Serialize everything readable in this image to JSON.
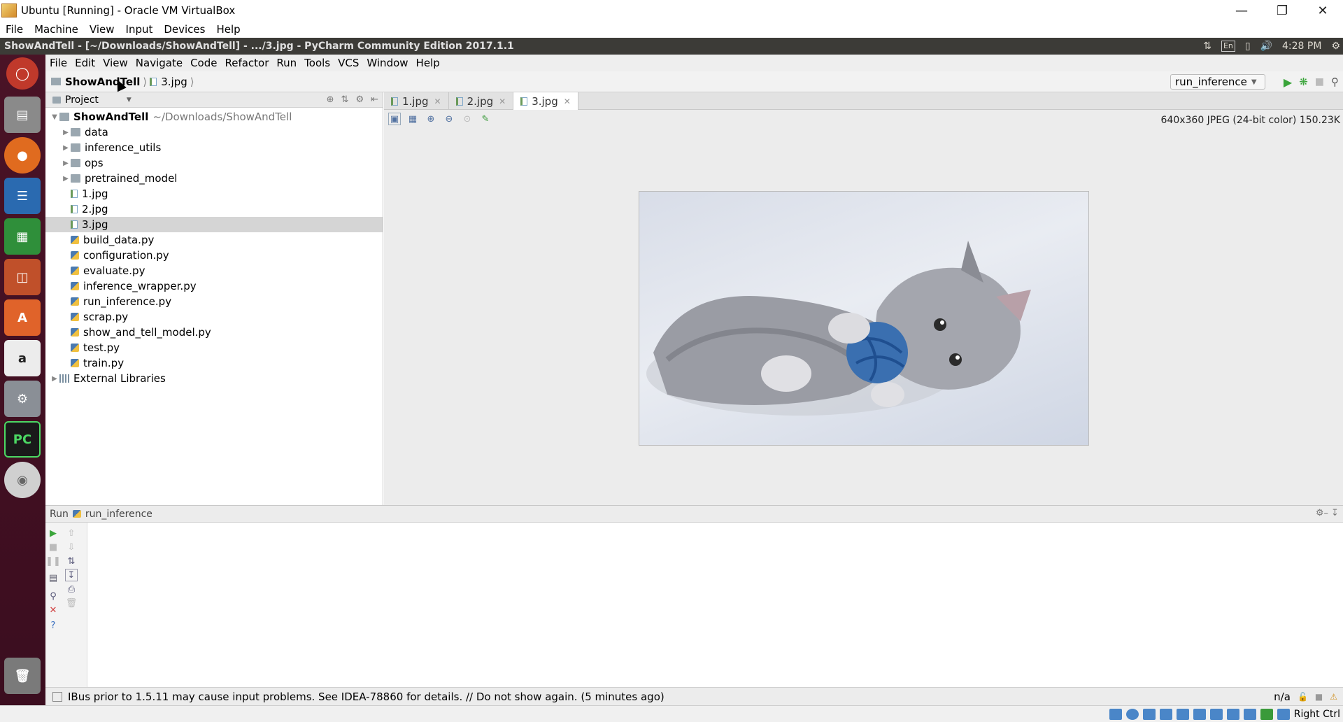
{
  "host": {
    "title": "Ubuntu [Running] - Oracle VM VirtualBox",
    "menu": [
      "File",
      "Machine",
      "View",
      "Input",
      "Devices",
      "Help"
    ],
    "status_right": "Right Ctrl"
  },
  "ubuntu_panel": {
    "window_title": "ShowAndTell - [~/Downloads/ShowAndTell] - .../3.jpg - PyCharm Community Edition 2017.1.1",
    "keyboard": "En",
    "time": "4:28 PM"
  },
  "launcher": {
    "items": [
      "ubuntu-dash",
      "files",
      "firefox",
      "writer",
      "calc",
      "impress",
      "software-center",
      "amazon",
      "system-settings",
      "pycharm",
      "dvd",
      "trash"
    ]
  },
  "pycharm": {
    "menu": [
      "File",
      "Edit",
      "View",
      "Navigate",
      "Code",
      "Refactor",
      "Run",
      "Tools",
      "VCS",
      "Window",
      "Help"
    ],
    "breadcrumb": {
      "project": "ShowAndTell",
      "file": "3.jpg"
    },
    "run_config": "run_inference",
    "project_panel": {
      "title": "Project",
      "root": {
        "name": "ShowAndTell",
        "path": "~/Downloads/ShowAndTell"
      },
      "folders": [
        "data",
        "inference_utils",
        "ops",
        "pretrained_model"
      ],
      "files": [
        "1.jpg",
        "2.jpg",
        "3.jpg",
        "build_data.py",
        "configuration.py",
        "evaluate.py",
        "inference_wrapper.py",
        "run_inference.py",
        "scrap.py",
        "show_and_tell_model.py",
        "test.py",
        "train.py"
      ],
      "external": "External Libraries"
    },
    "editor": {
      "tabs": [
        "1.jpg",
        "2.jpg",
        "3.jpg"
      ],
      "active_tab": "3.jpg",
      "image_info": "640x360 JPEG (24-bit color) 150.23K"
    },
    "run_panel": {
      "label": "Run",
      "config": "run_inference"
    },
    "status": {
      "message": "IBus prior to 1.5.11 may cause input problems. See IDEA-78860 for details. // Do not show again. (5 minutes ago)",
      "position": "n/a"
    }
  }
}
